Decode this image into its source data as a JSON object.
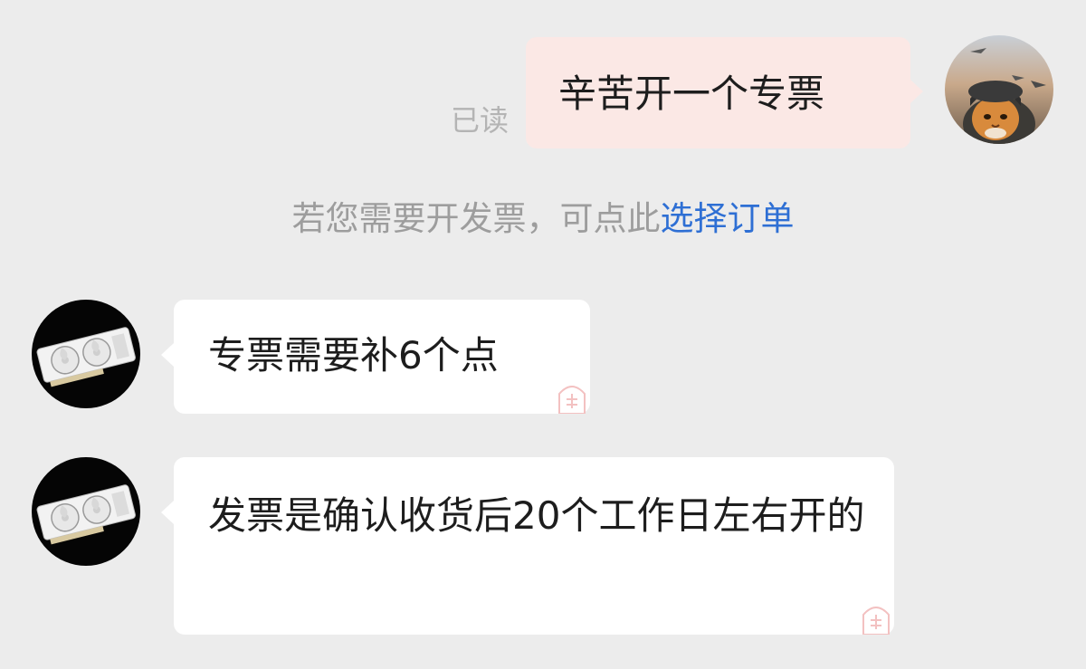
{
  "conversation": {
    "self_message": {
      "text": "辛苦开一个专票",
      "status": "已读"
    },
    "system_notice": {
      "text": "若您需要开发票，可点此",
      "link": "选择订单"
    },
    "replies": [
      {
        "text": "专票需要补6个点"
      },
      {
        "text": "发票是确认收货后20个工作日左右开的"
      }
    ]
  },
  "icons": {
    "self_avatar": "avatar-cat-pilot",
    "merchant_avatar": "avatar-graphics-card",
    "bubble_watermark": "pin-badge-icon"
  },
  "colors": {
    "background": "#ececec",
    "self_bubble": "#fbe8e5",
    "other_bubble": "#ffffff",
    "link": "#2e6fd4",
    "muted_text": "#9d9d9d"
  }
}
